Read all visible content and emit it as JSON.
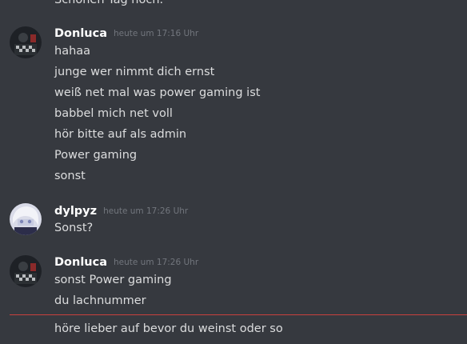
{
  "messages": {
    "top_cut": "Schönen Tag noch.",
    "group1": {
      "author": "Donluca",
      "timestamp": "heute um 17:16 Uhr",
      "lines": [
        "hahaa",
        "junge wer nimmt dich ernst",
        "weiß net mal was power gaming ist",
        "babbel mich net voll",
        "hör bitte auf als admin",
        "Power gaming",
        "sonst"
      ]
    },
    "group2": {
      "author": "dylpyz",
      "timestamp": "heute um 17:26 Uhr",
      "lines": [
        "Sonst?"
      ]
    },
    "group3": {
      "author": "Donluca",
      "timestamp": "heute um 17:26 Uhr",
      "lines": [
        "sonst Power gaming",
        "du lachnummer"
      ]
    },
    "after_divider": "höre lieber auf bevor du weinst oder so"
  },
  "colors": {
    "background": "#36393f",
    "text": "#dcddde",
    "username": "#ffffff",
    "timestamp": "#72767d",
    "new_messages_divider": "#c8413d"
  }
}
